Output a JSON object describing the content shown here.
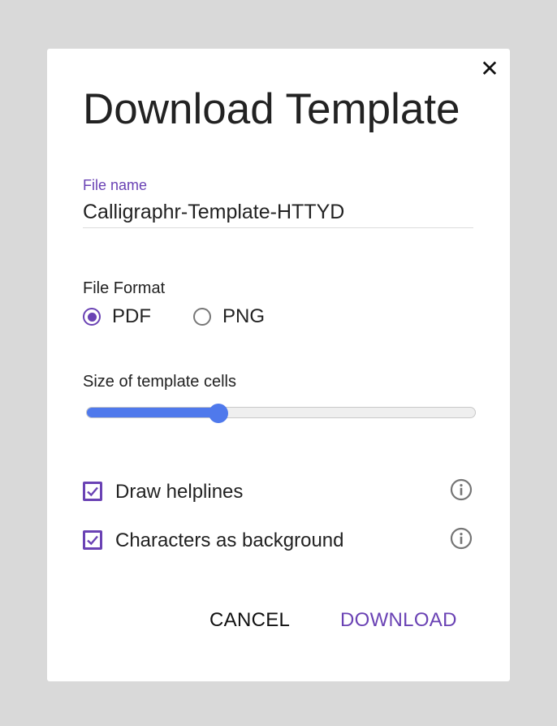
{
  "dialog": {
    "close_glyph": "✕",
    "title": "Download Template",
    "file_name": {
      "label": "File name",
      "value": "Calligraphr-Template-HTTYD"
    },
    "file_format": {
      "label": "File Format",
      "options": [
        {
          "label": "PDF",
          "selected": true
        },
        {
          "label": "PNG",
          "selected": false
        }
      ]
    },
    "cell_size": {
      "label": "Size of template cells",
      "value_fraction": 0.34
    },
    "options": [
      {
        "label": "Draw helplines",
        "checked": true,
        "icon": "info-icon"
      },
      {
        "label": "Characters as background",
        "checked": true,
        "icon": "info-icon"
      }
    ],
    "buttons": {
      "cancel": "CANCEL",
      "download": "DOWNLOAD"
    }
  },
  "colors": {
    "accent": "#6a42b4",
    "slider": "#4f79ec",
    "backdrop": "#d9d9d9"
  }
}
